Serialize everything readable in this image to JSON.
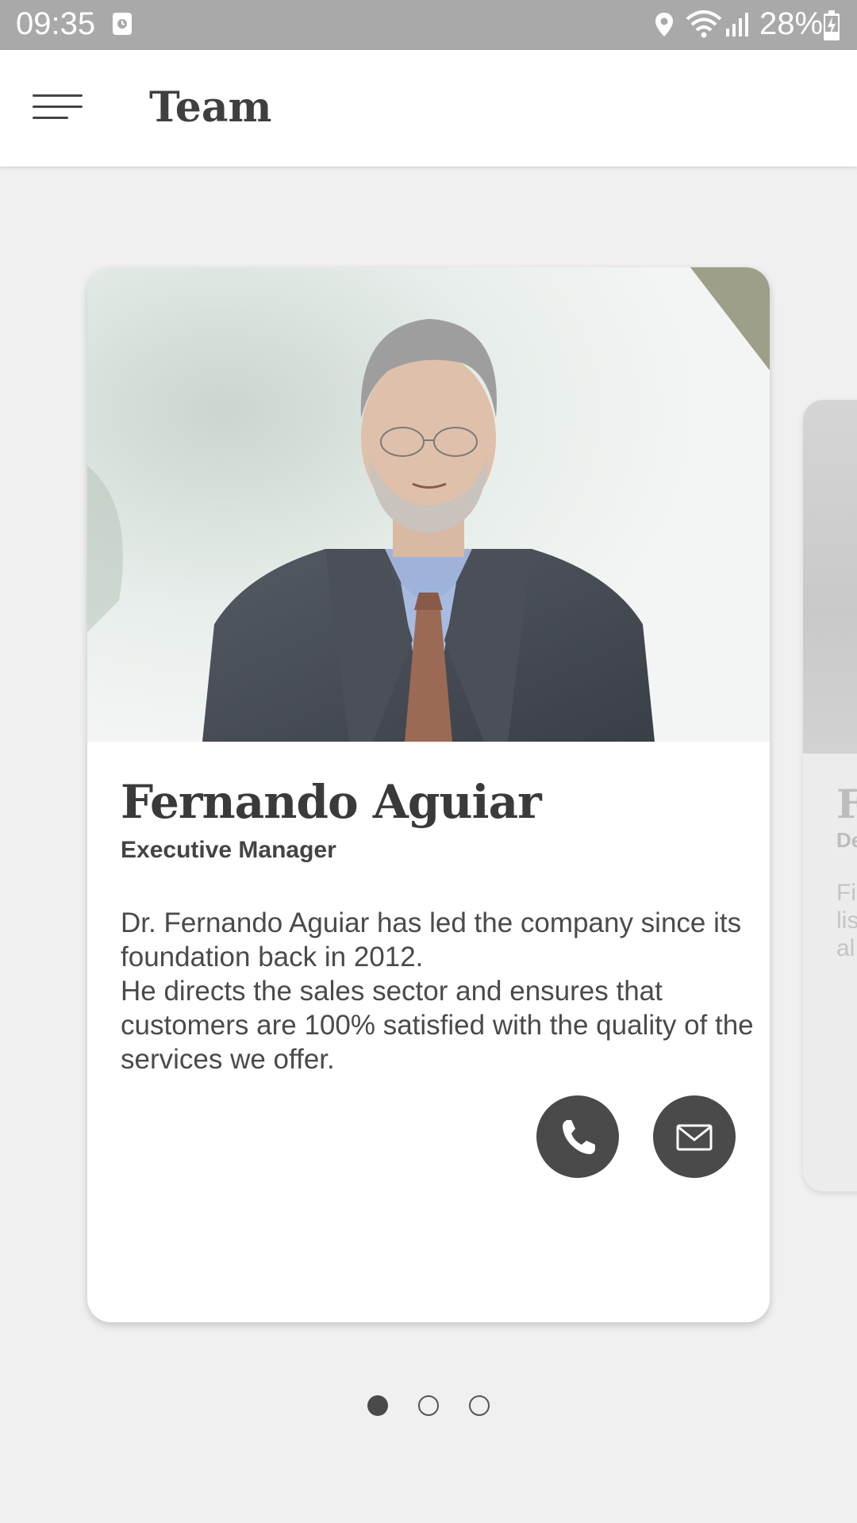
{
  "status_bar": {
    "time": "09:35",
    "battery": "28%",
    "icons": [
      "alarm-icon",
      "location-icon",
      "wifi-icon",
      "signal-icon",
      "battery-charging-icon"
    ]
  },
  "app_bar": {
    "title": "Team",
    "menu_icon": "hamburger-menu-icon"
  },
  "cards": [
    {
      "name": "Fernando Aguiar",
      "role": "Executive Manager",
      "bio": [
        "Dr. Fernando Aguiar has led the company since its foundation back in 2012.",
        "He directs the sales sector and ensures that customers are 100% satisfied with the quality of the services we offer."
      ],
      "actions": [
        "phone-icon",
        "mail-icon"
      ]
    },
    {
      "name_partial": "F",
      "role_partial": "De",
      "bio_partial": [
        "Fi",
        "lis",
        "al"
      ]
    }
  ],
  "pager": {
    "count": 3,
    "active_index": 0
  },
  "colors": {
    "status_bar": "#a9a9a9",
    "app_bar": "#ffffff",
    "background": "#f0f0f0",
    "text_dark": "#3a3a3a",
    "button": "#4a4a4a"
  }
}
